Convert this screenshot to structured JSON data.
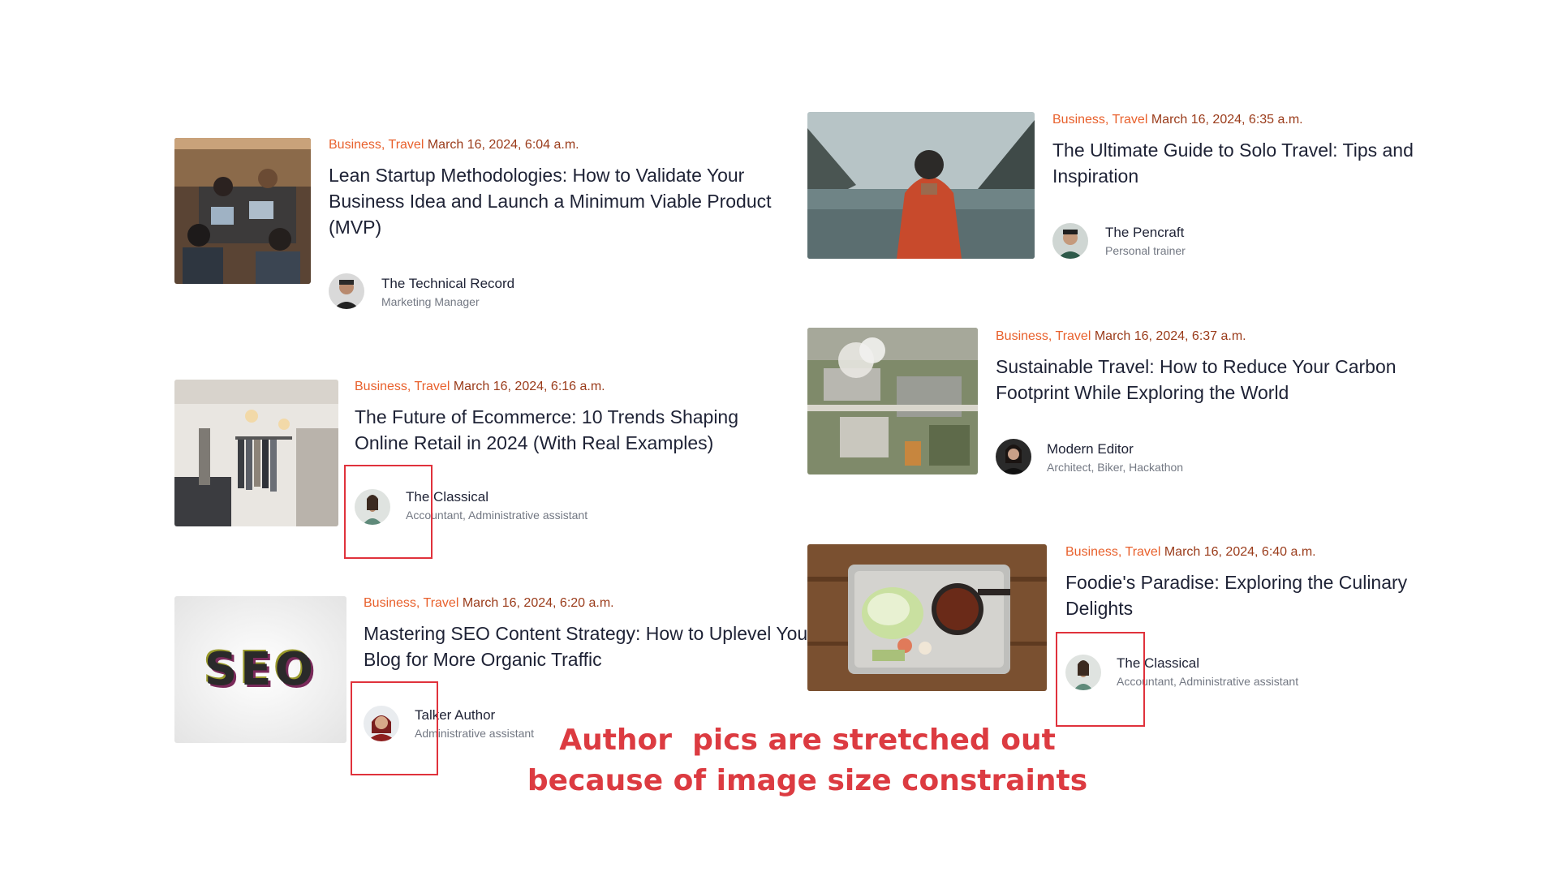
{
  "posts": [
    {
      "categories": "Business, Travel",
      "date": "March 16, 2024, 6:04 a.m.",
      "title": "Lean Startup Methodologies: How to Validate Your Business Idea and Launch a Minimum Viable Product (MVP)",
      "author": {
        "name": "The Technical Record",
        "role": "Marketing Manager"
      },
      "thumbnail_icon": "office-team-photo"
    },
    {
      "categories": "Business, Travel",
      "date": "March 16, 2024, 6:35 a.m.",
      "title": "The Ultimate Guide to Solo Travel: Tips and Inspiration",
      "author": {
        "name": "The Pencraft",
        "role": "Personal trainer"
      },
      "thumbnail_icon": "backpacker-lake-photo"
    },
    {
      "categories": "Business, Travel",
      "date": "March 16, 2024, 6:16 a.m.",
      "title": "The Future of Ecommerce: 10 Trends Shaping Online Retail in 2024 (With Real Examples)",
      "author": {
        "name": "The Classical",
        "role": "Accountant, Administrative assistant"
      },
      "thumbnail_icon": "clothing-store-photo"
    },
    {
      "categories": "Business, Travel",
      "date": "March 16, 2024, 6:37 a.m.",
      "title": "Sustainable Travel: How to Reduce Your Carbon Footprint While Exploring the World",
      "author": {
        "name": "Modern Editor",
        "role": "Architect, Biker, Hackathon"
      },
      "thumbnail_icon": "aerial-factory-photo"
    },
    {
      "categories": "Business, Travel",
      "date": "March 16, 2024, 6:20 a.m.",
      "title": "Mastering SEO Content Strategy: How to Uplevel Your Blog for More Organic Traffic",
      "author": {
        "name": "Talker Author",
        "role": "Administrative assistant"
      },
      "thumbnail_icon": "seo-letters-photo",
      "thumbnail_text": "SEO"
    },
    {
      "categories": "Business, Travel",
      "date": "March 16, 2024, 6:40 a.m.",
      "title": "Foodie's Paradise: Exploring the Culinary Delights",
      "author": {
        "name": "The Classical",
        "role": "Accountant, Administrative assistant"
      },
      "thumbnail_icon": "food-tray-photo"
    }
  ],
  "annotation": {
    "line1": "Author  pics are stretched out",
    "line2": "because of image size constraints",
    "highlight_color": "#e0323c",
    "text_color": "#dc3b41"
  },
  "colors": {
    "category": "#e8602c",
    "date": "#9a3b1a",
    "title": "#1e2235",
    "role": "#737883"
  }
}
